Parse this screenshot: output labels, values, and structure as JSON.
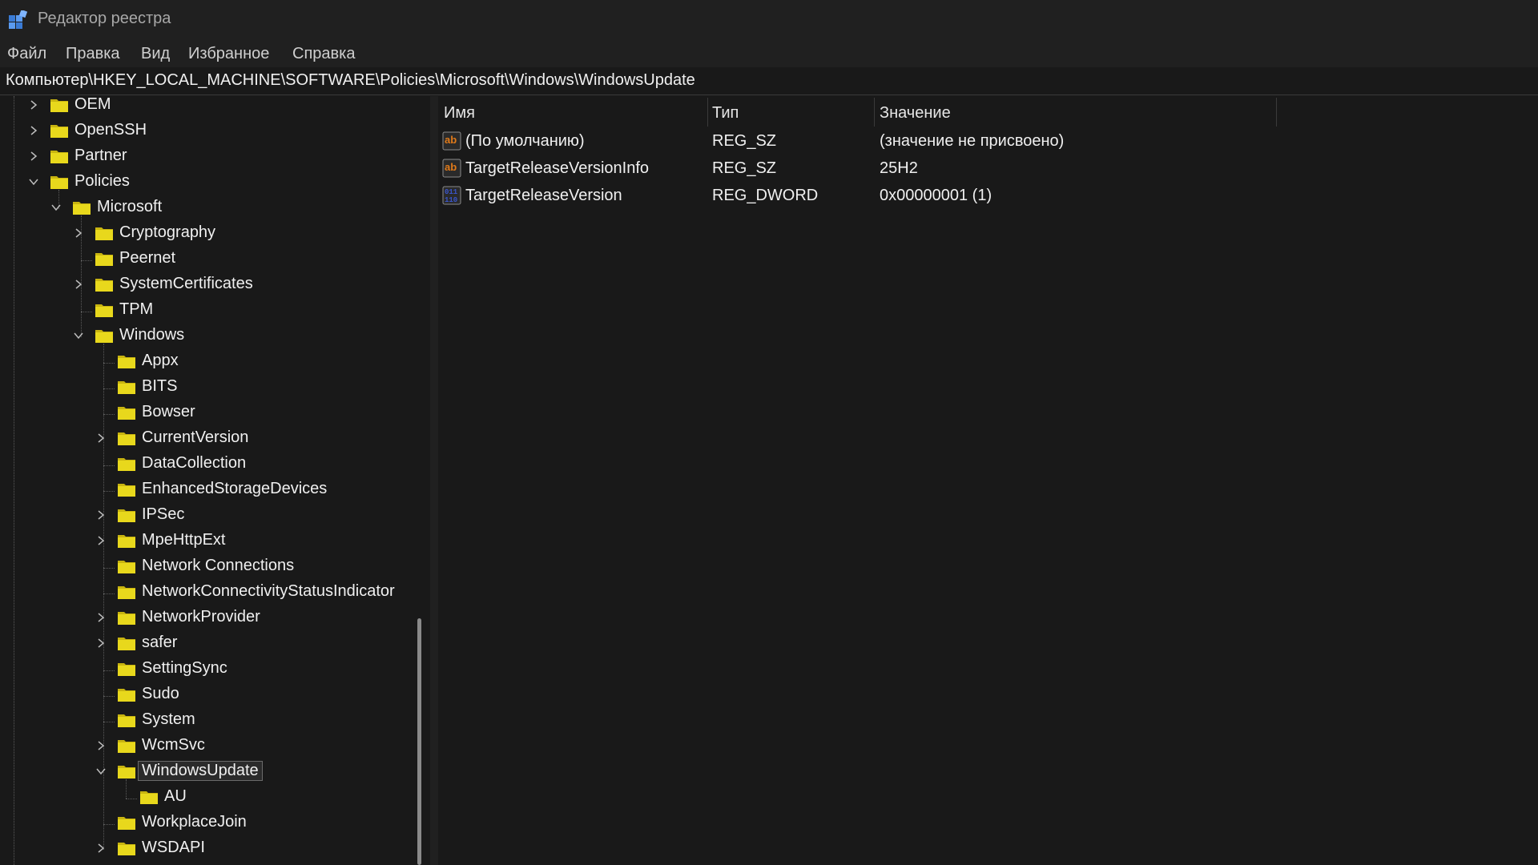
{
  "window": {
    "title": "Редактор реестра"
  },
  "menu": [
    "Файл",
    "Правка",
    "Вид",
    "Избранное",
    "Справка"
  ],
  "address": "Компьютер\\HKEY_LOCAL_MACHINE\\SOFTWARE\\Policies\\Microsoft\\Windows\\WindowsUpdate",
  "tree": [
    {
      "label": "OEM",
      "level": 0,
      "expander": "closed"
    },
    {
      "label": "OpenSSH",
      "level": 0,
      "expander": "closed"
    },
    {
      "label": "Partner",
      "level": 0,
      "expander": "closed"
    },
    {
      "label": "Policies",
      "level": 0,
      "expander": "open"
    },
    {
      "label": "Microsoft",
      "level": 1,
      "expander": "open"
    },
    {
      "label": "Cryptography",
      "level": 2,
      "expander": "closed"
    },
    {
      "label": "Peernet",
      "level": 2,
      "expander": "none"
    },
    {
      "label": "SystemCertificates",
      "level": 2,
      "expander": "closed"
    },
    {
      "label": "TPM",
      "level": 2,
      "expander": "none"
    },
    {
      "label": "Windows",
      "level": 2,
      "expander": "open"
    },
    {
      "label": "Appx",
      "level": 3,
      "expander": "none"
    },
    {
      "label": "BITS",
      "level": 3,
      "expander": "none"
    },
    {
      "label": "Bowser",
      "level": 3,
      "expander": "none"
    },
    {
      "label": "CurrentVersion",
      "level": 3,
      "expander": "closed"
    },
    {
      "label": "DataCollection",
      "level": 3,
      "expander": "none"
    },
    {
      "label": "EnhancedStorageDevices",
      "level": 3,
      "expander": "none"
    },
    {
      "label": "IPSec",
      "level": 3,
      "expander": "closed"
    },
    {
      "label": "MpeHttpExt",
      "level": 3,
      "expander": "closed"
    },
    {
      "label": "Network Connections",
      "level": 3,
      "expander": "none"
    },
    {
      "label": "NetworkConnectivityStatusIndicator",
      "level": 3,
      "expander": "none"
    },
    {
      "label": "NetworkProvider",
      "level": 3,
      "expander": "closed"
    },
    {
      "label": "safer",
      "level": 3,
      "expander": "closed"
    },
    {
      "label": "SettingSync",
      "level": 3,
      "expander": "none"
    },
    {
      "label": "Sudo",
      "level": 3,
      "expander": "none"
    },
    {
      "label": "System",
      "level": 3,
      "expander": "none"
    },
    {
      "label": "WcmSvc",
      "level": 3,
      "expander": "closed"
    },
    {
      "label": "WindowsUpdate",
      "level": 3,
      "expander": "open",
      "selected": true
    },
    {
      "label": "AU",
      "level": 4,
      "expander": "none"
    },
    {
      "label": "WorkplaceJoin",
      "level": 3,
      "expander": "none"
    },
    {
      "label": "WSDAPI",
      "level": 3,
      "expander": "closed"
    }
  ],
  "columns": {
    "name": "Имя",
    "type": "Тип",
    "value": "Значение"
  },
  "values": [
    {
      "icon": "string-value-icon",
      "name": "(По умолчанию)",
      "type": "REG_SZ",
      "data": "(значение не присвоено)"
    },
    {
      "icon": "string-value-icon",
      "name": "TargetReleaseVersionInfo",
      "type": "REG_SZ",
      "data": "25H2"
    },
    {
      "icon": "dword-value-icon",
      "name": "TargetReleaseVersion",
      "type": "REG_DWORD",
      "data": "0x00000001 (1)"
    }
  ],
  "colors": {
    "folder": "#e8d81c",
    "folderDark": "#c8b410",
    "accent": "#3a7bd5",
    "stringIcon": "#e07a1a",
    "dwordIcon": "#3a55c8"
  }
}
